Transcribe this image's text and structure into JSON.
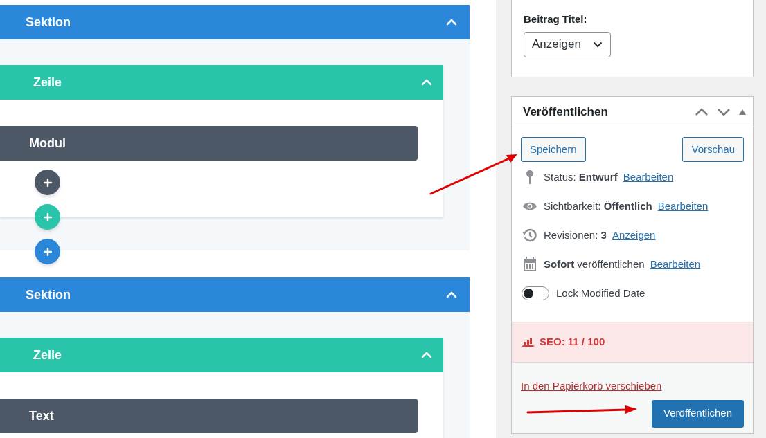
{
  "builder": {
    "sections": [
      {
        "label": "Sektion",
        "expanded": true,
        "rows": [
          {
            "label": "Zeile",
            "expanded": true,
            "modules": [
              {
                "label": "Modul"
              }
            ]
          }
        ],
        "add_buttons": [
          {
            "kind": "module"
          },
          {
            "kind": "row"
          },
          {
            "kind": "section"
          }
        ]
      },
      {
        "label": "Sektion",
        "expanded": true,
        "rows": [
          {
            "label": "Zeile",
            "expanded": true,
            "modules": [
              {
                "label": "Text"
              }
            ]
          }
        ]
      }
    ]
  },
  "title_box": {
    "label": "Beitrag Titel:",
    "select_value": "Anzeigen"
  },
  "publish_box": {
    "title": "Veröffentlichen",
    "save_button": "Speichern",
    "preview_button": "Vorschau",
    "misc": [
      {
        "kind": "pin",
        "text": "Status: **Entwurf**",
        "link": "Bearbeiten"
      },
      {
        "kind": "eye",
        "text": "Sichtbarkeit: **Öffentlich**",
        "link": "Bearbeiten"
      },
      {
        "kind": "history",
        "text": "Revisionen: **3**",
        "link": "Anzeigen"
      },
      {
        "kind": "calendar",
        "text": "**Sofort** veröffentlichen",
        "link": "Bearbeiten"
      }
    ],
    "toggle": {
      "label": "Lock Modified Date",
      "on": false
    },
    "seo": "SEO: 11 / 100",
    "trash_link": "In den Papierkorb verschieben",
    "publish_button": "Veröffentlichen"
  }
}
